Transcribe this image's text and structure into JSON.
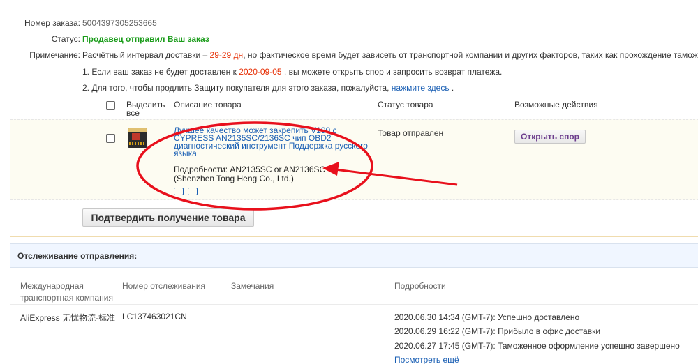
{
  "order": {
    "number_label": "Номер заказа:",
    "number_value": "5004397305253665",
    "status_label": "Статус:",
    "status_value": "Продавец отправил Ваш заказ",
    "note_label": "Примечание:",
    "note_prefix": "Расчётный интервал доставки – ",
    "note_days": "29-29 дн",
    "note_suffix": ", но фактическое время будет зависеть от транспортной компании и других факторов, таких как прохождение таможни.",
    "line1_prefix": "1. Если ваш заказ не будет доставлен к ",
    "line1_date": "2020-09-05",
    "line1_suffix": " , вы можете открыть спор и запросить возврат платежа.",
    "line2_prefix": "2. Для того, чтобы продлить Защиту покупателя для этого заказа, пожалуйста, ",
    "line2_link": "нажмите здесь",
    "line2_suffix": " ."
  },
  "table": {
    "headers": {
      "select_all": "Выделить все",
      "description": "Описание товара",
      "status": "Статус товара",
      "actions": "Возможные действия"
    },
    "item": {
      "title": "Лучшее качество может закрепить V190 с CYPRESS AN2135SC/2136SC чип OBD2 диагностический инструмент Поддержка русского языка",
      "details": "Подробности: AN2135SC or AN2136SC",
      "seller": "(Shenzhen Tong Heng Co., Ltd.)",
      "status": "Товар отправлен",
      "action_button": "Открыть спор"
    }
  },
  "confirm_button": "Подтвердить получение товара",
  "tracking": {
    "header": "Отслеживание отправления:",
    "columns": {
      "carrier": "Международная транспортная компания",
      "tracking_no": "Номер отслеживания",
      "remarks": "Замечания",
      "details": "Подробности"
    },
    "row": {
      "carrier": "AliExpress 无忧物流-标准",
      "tracking_no": "LC137463021CN",
      "events": [
        "2020.06.30 14:34 (GMT-7): Успешно доставлено",
        "2020.06.29 16:22 (GMT-7): Прибыло в офис доставки",
        "2020.06.27 17:45 (GMT-7): Таможенное оформление успешно завершено"
      ],
      "more_link": "Посмотреть ещё"
    }
  },
  "colors": {
    "annotation": "#e8101c",
    "link": "#1a5fb4",
    "status_green": "#1a9c1a",
    "highlight_red": "#e62e04"
  }
}
